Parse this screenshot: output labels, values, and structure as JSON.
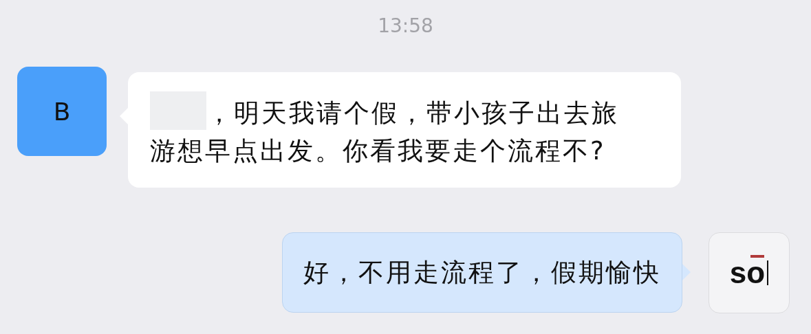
{
  "timestamp": "13:58",
  "messages": [
    {
      "kind": "incoming",
      "avatar": {
        "kind": "letter",
        "text": "B"
      },
      "redacted": true,
      "text": "，明天我请个假，带小孩子出去旅游想早点出发。你看我要走个流程不?"
    },
    {
      "kind": "outgoing",
      "avatar": {
        "kind": "logo",
        "text": "so"
      },
      "text": "好，不用走流程了，假期愉快"
    }
  ]
}
